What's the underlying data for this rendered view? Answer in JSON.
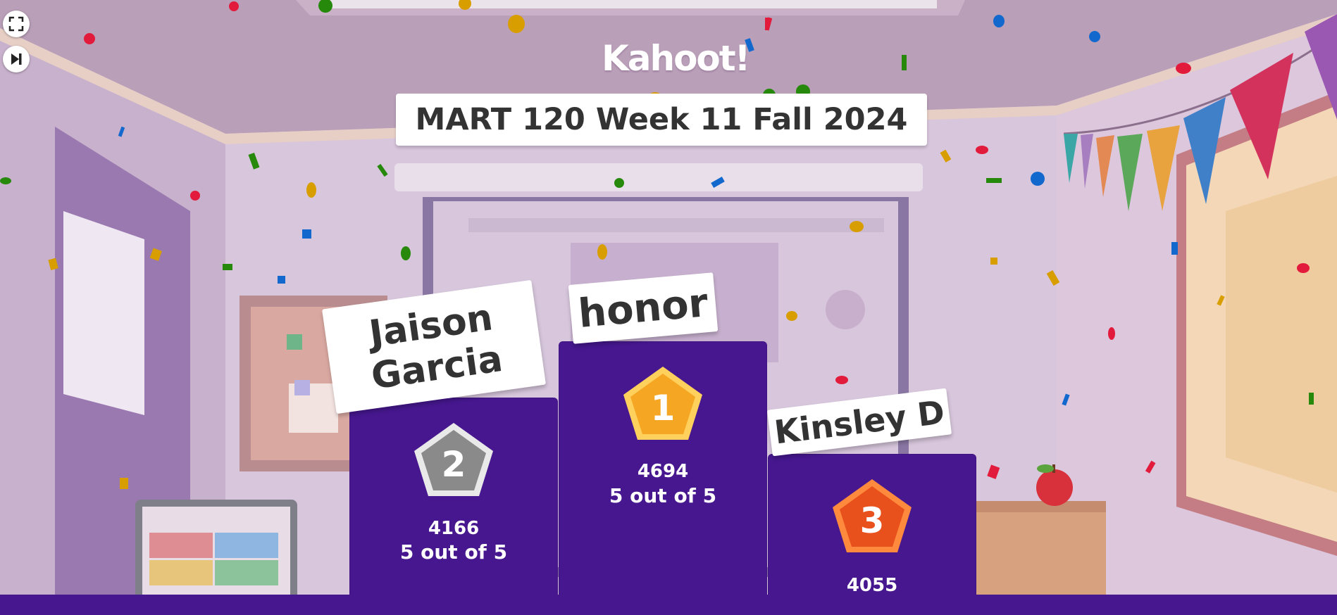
{
  "app": {
    "logo_text": "Kahoot!"
  },
  "controls": {
    "fullscreen_icon": "fullscreen-icon",
    "skip_icon": "skip-next-icon"
  },
  "quiz": {
    "title": "MART 120 Week 11 Fall 2024"
  },
  "podium": [
    {
      "rank": "2",
      "name": "Jaison Garcia",
      "score": "4166",
      "correct": "5 out of 5",
      "medal_color": "#8a8a8a"
    },
    {
      "rank": "1",
      "name": "honor",
      "score": "4694",
      "correct": "5 out of 5",
      "medal_color": "#f5a623"
    },
    {
      "rank": "3",
      "name": "Kinsley D",
      "score": "4055",
      "correct": "",
      "medal_color": "#e8501c"
    }
  ],
  "colors": {
    "podium": "#46178f",
    "bar": "#46178f"
  }
}
